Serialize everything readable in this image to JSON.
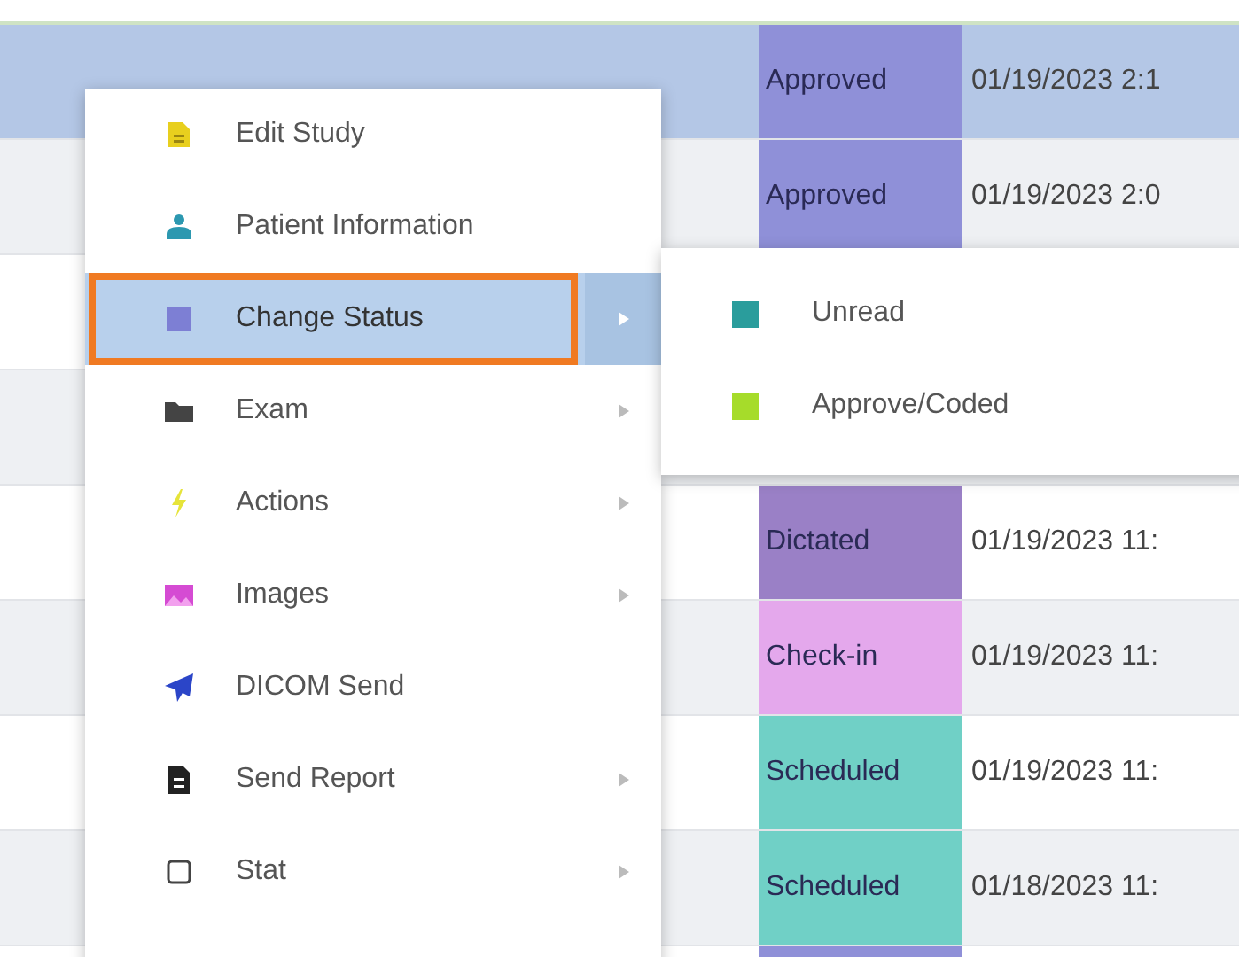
{
  "table": {
    "rows": [
      {
        "selected": true,
        "status": "Approved",
        "color": "#8f90d8",
        "date": "01/19/2023 2:1"
      },
      {
        "selected": false,
        "status": "Approved",
        "color": "#8f90d8",
        "date": "01/19/2023 2:0"
      },
      {
        "selected": false
      },
      {
        "selected": false
      },
      {
        "selected": false,
        "status": "Dictated",
        "color": "#9a80c6",
        "date": "01/19/2023 11:"
      },
      {
        "selected": false,
        "status": "Check-in",
        "color": "#e4a8ec",
        "date": "01/19/2023 11:"
      },
      {
        "selected": false,
        "status": "Scheduled",
        "color": "#70d0c6",
        "date": "01/19/2023 11:"
      },
      {
        "selected": false,
        "status": "Scheduled",
        "color": "#70d0c6",
        "date": "01/18/2023 11:"
      },
      {
        "selected": false,
        "color": "#8f90d8"
      }
    ]
  },
  "context_menu": {
    "items": [
      {
        "label": "Edit Study",
        "has_submenu": false,
        "selected": false
      },
      {
        "label": "Patient Information",
        "has_submenu": false,
        "selected": false
      },
      {
        "label": "Change Status",
        "has_submenu": true,
        "selected": true
      },
      {
        "label": "Exam",
        "has_submenu": true,
        "selected": false
      },
      {
        "label": "Actions",
        "has_submenu": true,
        "selected": false
      },
      {
        "label": "Images",
        "has_submenu": true,
        "selected": false
      },
      {
        "label": "DICOM Send",
        "has_submenu": false,
        "selected": false
      },
      {
        "label": "Send Report",
        "has_submenu": true,
        "selected": false
      },
      {
        "label": "Stat",
        "has_submenu": true,
        "selected": false
      }
    ]
  },
  "submenu": {
    "items": [
      {
        "label": "Unread",
        "color": "#2a9d9c"
      },
      {
        "label": "Approve/Coded",
        "color": "#a6dc2a"
      }
    ]
  }
}
